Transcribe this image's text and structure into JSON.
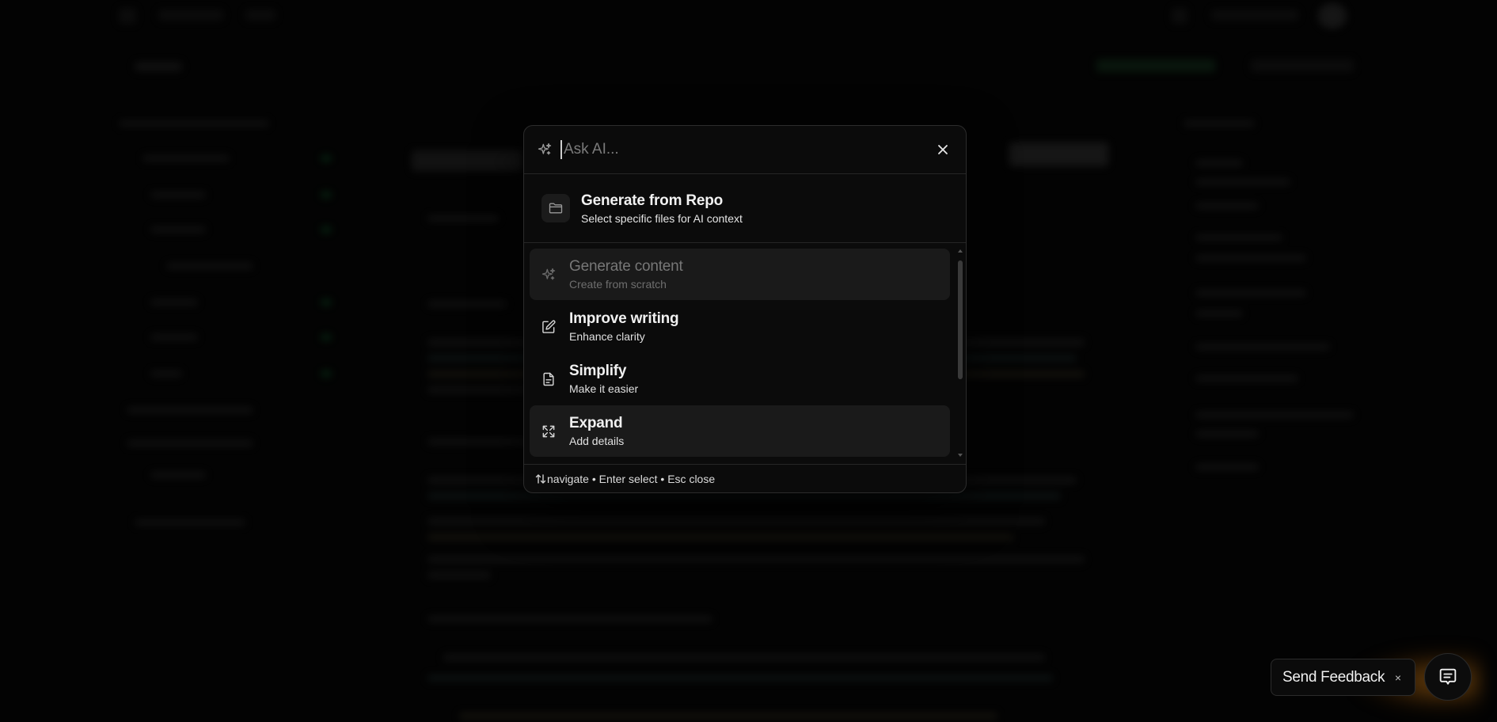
{
  "colors": {
    "background": "#050505",
    "panel": "#0b0b0b",
    "border": "#2c2c2c",
    "active_item": "#1a1a1a",
    "glow": "#c87814"
  },
  "search": {
    "icon": "sparkle-icon",
    "placeholder": "Ask AI...",
    "value": ""
  },
  "close_icon": "close-icon",
  "repo_action": {
    "icon": "folder-icon",
    "title": "Generate from Repo",
    "subtitle": "Select specific files for AI context"
  },
  "actions": [
    {
      "icon": "sparkle-icon",
      "title": "Generate content",
      "subtitle": "Create from scratch"
    },
    {
      "icon": "pencil-icon",
      "title": "Improve writing",
      "subtitle": "Enhance clarity"
    },
    {
      "icon": "document-icon",
      "title": "Simplify",
      "subtitle": "Make it easier"
    },
    {
      "icon": "expand-icon",
      "title": "Expand",
      "subtitle": "Add details"
    }
  ],
  "footer": {
    "icon": "up-down-arrows-icon",
    "hint": "navigate • Enter select • Esc close"
  },
  "feedback": {
    "label": "Send Feedback",
    "close": "×"
  },
  "chat_button": {
    "icon": "chat-bubble-icon"
  }
}
